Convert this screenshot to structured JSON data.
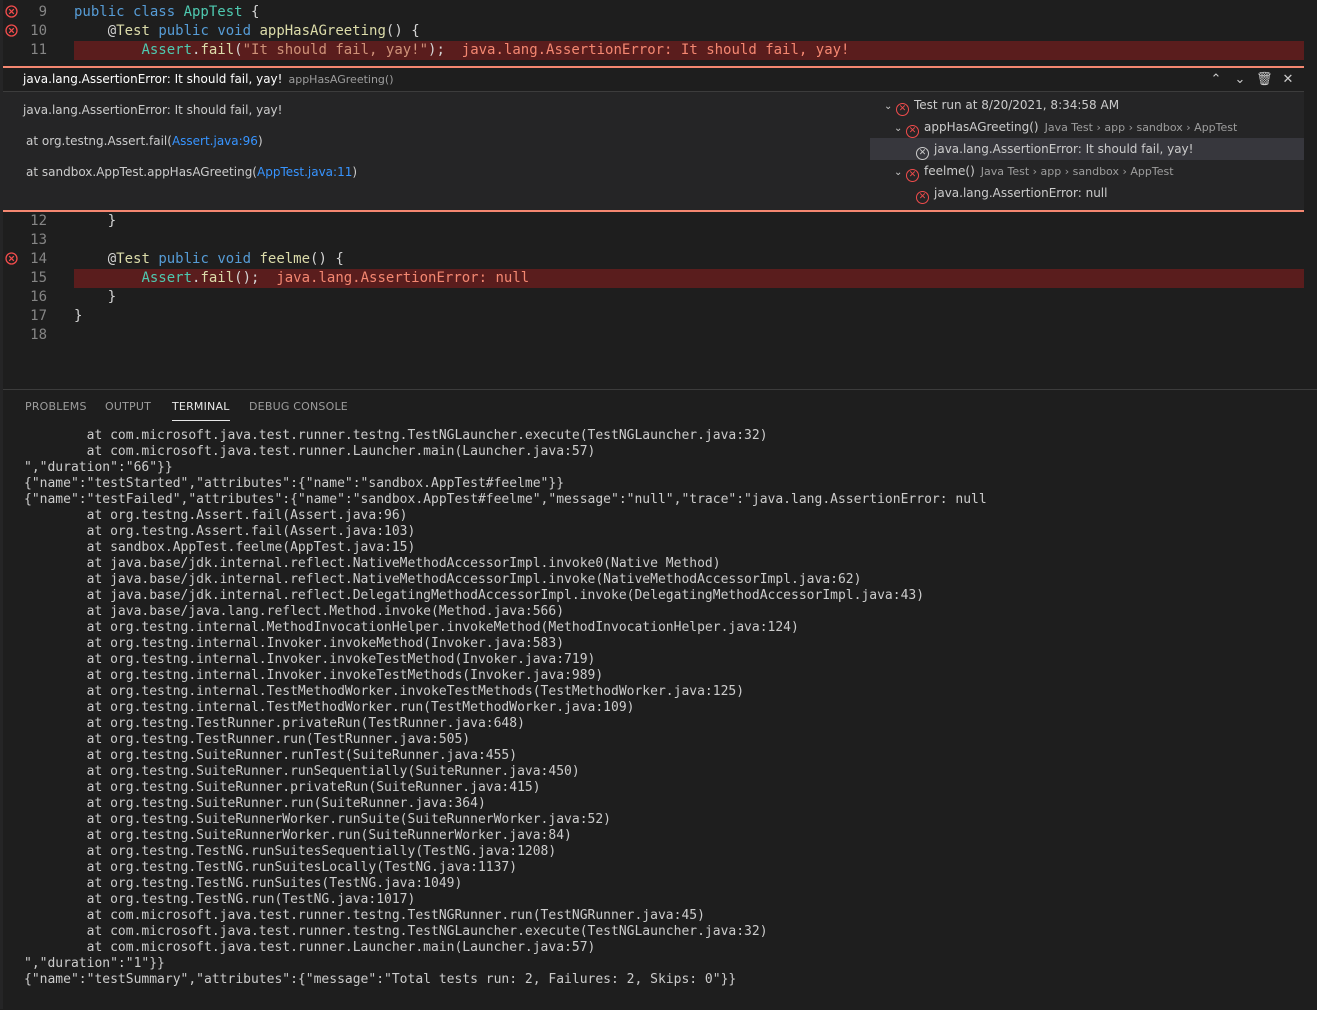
{
  "editor": {
    "top_lines": [
      {
        "num": "9",
        "error": true,
        "tokens": [
          [
            "kw",
            "public class "
          ],
          [
            "ty",
            "AppTest"
          ],
          [
            "plain",
            " {"
          ]
        ]
      },
      {
        "num": "10",
        "error": true,
        "tokens": [
          [
            "plain",
            "    @"
          ],
          [
            "ann",
            "Test "
          ],
          [
            "kw",
            "public void "
          ],
          [
            "fn",
            "appHasAGreeting"
          ],
          [
            "plain",
            "() {"
          ]
        ]
      },
      {
        "num": "11",
        "error": false,
        "highlight": true,
        "tokens": [
          [
            "plain",
            "        "
          ],
          [
            "ty",
            "Assert"
          ],
          [
            "plain",
            "."
          ],
          [
            "fn",
            "fail"
          ],
          [
            "plain",
            "("
          ],
          [
            "str",
            "\"It should fail, yay!\""
          ],
          [
            "plain",
            ");"
          ]
        ],
        "inline_error": "java.lang.AssertionError: It should fail, yay!"
      }
    ],
    "bottom_lines": [
      {
        "num": "12",
        "error": false,
        "tokens": [
          [
            "plain",
            "    }"
          ]
        ]
      },
      {
        "num": "13",
        "error": false,
        "tokens": [
          [
            "plain",
            ""
          ]
        ]
      },
      {
        "num": "14",
        "error": true,
        "tokens": [
          [
            "plain",
            "    @"
          ],
          [
            "ann",
            "Test "
          ],
          [
            "kw",
            "public void "
          ],
          [
            "fn",
            "feelme"
          ],
          [
            "plain",
            "() {"
          ]
        ]
      },
      {
        "num": "15",
        "error": false,
        "highlight": true,
        "tokens": [
          [
            "plain",
            "        "
          ],
          [
            "ty",
            "Assert"
          ],
          [
            "plain",
            "."
          ],
          [
            "fn",
            "fail"
          ],
          [
            "plain",
            "();"
          ]
        ],
        "inline_error": "java.lang.AssertionError: null"
      },
      {
        "num": "16",
        "error": false,
        "tokens": [
          [
            "plain",
            "    }"
          ]
        ]
      },
      {
        "num": "17",
        "error": false,
        "tokens": [
          [
            "plain",
            "}"
          ]
        ]
      },
      {
        "num": "18",
        "error": false,
        "tokens": [
          [
            "plain",
            ""
          ]
        ]
      }
    ]
  },
  "peek": {
    "title": "java.lang.AssertionError: It should fail, yay!",
    "subtitle": "appHasAGreeting()",
    "message": "java.lang.AssertionError: It should fail, yay!",
    "stack": [
      {
        "prefix": "at org.testng.Assert.fail(",
        "link": "Assert.java:96",
        "suffix": ")"
      },
      {
        "prefix": "at sandbox.AppTest.appHasAGreeting(",
        "link": "AppTest.java:11",
        "suffix": ")"
      }
    ],
    "tree": [
      {
        "indent": 0,
        "chevron": true,
        "icon": "error",
        "label": "Test run at 8/20/2021, 8:34:58 AM",
        "meta": ""
      },
      {
        "indent": 1,
        "chevron": true,
        "icon": "error",
        "label": "appHasAGreeting()",
        "meta": "Java Test › app › sandbox › AppTest"
      },
      {
        "indent": 2,
        "chevron": false,
        "icon": "grey",
        "label": "java.lang.AssertionError: It should fail, yay!",
        "meta": "",
        "selected": true
      },
      {
        "indent": 1,
        "chevron": true,
        "icon": "error",
        "label": "feelme()",
        "meta": "Java Test › app › sandbox › AppTest"
      },
      {
        "indent": 2,
        "chevron": false,
        "icon": "error",
        "label": "java.lang.AssertionError: null",
        "meta": ""
      }
    ]
  },
  "panel": {
    "tabs": [
      "PROBLEMS",
      "OUTPUT",
      "TERMINAL",
      "DEBUG CONSOLE"
    ],
    "active_tab": "TERMINAL",
    "terminal_lines": [
      "        at com.microsoft.java.test.runner.testng.TestNGLauncher.execute(TestNGLauncher.java:32)",
      "        at com.microsoft.java.test.runner.Launcher.main(Launcher.java:57)",
      "\",\"duration\":\"66\"}}",
      "{\"name\":\"testStarted\",\"attributes\":{\"name\":\"sandbox.AppTest#feelme\"}}",
      "{\"name\":\"testFailed\",\"attributes\":{\"name\":\"sandbox.AppTest#feelme\",\"message\":\"null\",\"trace\":\"java.lang.AssertionError: null",
      "        at org.testng.Assert.fail(Assert.java:96)",
      "        at org.testng.Assert.fail(Assert.java:103)",
      "        at sandbox.AppTest.feelme(AppTest.java:15)",
      "        at java.base/jdk.internal.reflect.NativeMethodAccessorImpl.invoke0(Native Method)",
      "        at java.base/jdk.internal.reflect.NativeMethodAccessorImpl.invoke(NativeMethodAccessorImpl.java:62)",
      "        at java.base/jdk.internal.reflect.DelegatingMethodAccessorImpl.invoke(DelegatingMethodAccessorImpl.java:43)",
      "        at java.base/java.lang.reflect.Method.invoke(Method.java:566)",
      "        at org.testng.internal.MethodInvocationHelper.invokeMethod(MethodInvocationHelper.java:124)",
      "        at org.testng.internal.Invoker.invokeMethod(Invoker.java:583)",
      "        at org.testng.internal.Invoker.invokeTestMethod(Invoker.java:719)",
      "        at org.testng.internal.Invoker.invokeTestMethods(Invoker.java:989)",
      "        at org.testng.internal.TestMethodWorker.invokeTestMethods(TestMethodWorker.java:125)",
      "        at org.testng.internal.TestMethodWorker.run(TestMethodWorker.java:109)",
      "        at org.testng.TestRunner.privateRun(TestRunner.java:648)",
      "        at org.testng.TestRunner.run(TestRunner.java:505)",
      "        at org.testng.SuiteRunner.runTest(SuiteRunner.java:455)",
      "        at org.testng.SuiteRunner.runSequentially(SuiteRunner.java:450)",
      "        at org.testng.SuiteRunner.privateRun(SuiteRunner.java:415)",
      "        at org.testng.SuiteRunner.run(SuiteRunner.java:364)",
      "        at org.testng.SuiteRunnerWorker.runSuite(SuiteRunnerWorker.java:52)",
      "        at org.testng.SuiteRunnerWorker.run(SuiteRunnerWorker.java:84)",
      "        at org.testng.TestNG.runSuitesSequentially(TestNG.java:1208)",
      "        at org.testng.TestNG.runSuitesLocally(TestNG.java:1137)",
      "        at org.testng.TestNG.runSuites(TestNG.java:1049)",
      "        at org.testng.TestNG.run(TestNG.java:1017)",
      "        at com.microsoft.java.test.runner.testng.TestNGRunner.run(TestNGRunner.java:45)",
      "        at com.microsoft.java.test.runner.testng.TestNGLauncher.execute(TestNGLauncher.java:32)",
      "        at com.microsoft.java.test.runner.Launcher.main(Launcher.java:57)",
      "\",\"duration\":\"1\"}}",
      "{\"name\":\"testSummary\",\"attributes\":{\"message\":\"Total tests run: 2, Failures: 2, Skips: 0\"}}"
    ]
  },
  "colors": {
    "error": "#f14c4c",
    "error_line_bg": "#5a1d1d",
    "peek_border": "#f48771",
    "link": "#3794ff"
  }
}
